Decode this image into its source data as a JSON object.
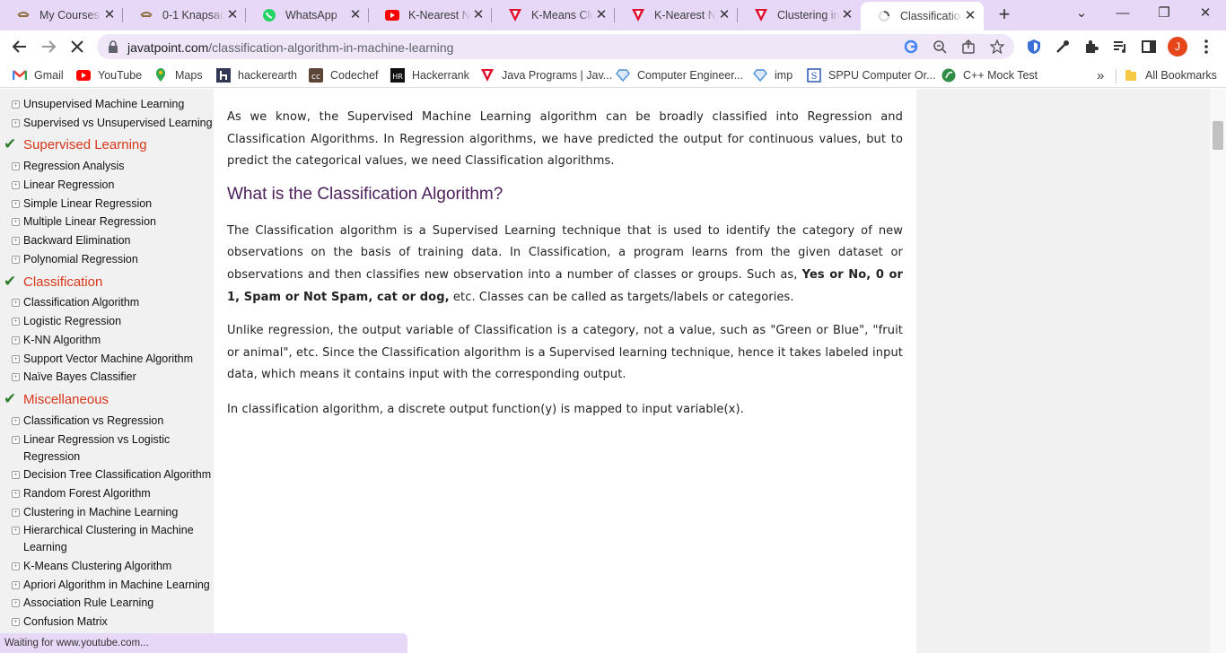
{
  "tabs": [
    {
      "title": "My Courses",
      "icon": "course-icon"
    },
    {
      "title": "0-1 Knapsack",
      "icon": "course-icon"
    },
    {
      "title": "WhatsApp",
      "icon": "whatsapp-icon"
    },
    {
      "title": "K-Nearest Neighbor",
      "icon": "youtube-icon"
    },
    {
      "title": "K-Means Clustering",
      "icon": "javatpoint-icon"
    },
    {
      "title": "K-Nearest Neighbor",
      "icon": "javatpoint-icon"
    },
    {
      "title": "Clustering in",
      "icon": "javatpoint-icon"
    },
    {
      "title": "Classification",
      "icon": "loading-icon",
      "active": true
    }
  ],
  "toolbar": {
    "url_host": "javatpoint.com",
    "url_path": "/classification-algorithm-in-machine-learning",
    "profile_initial": "J"
  },
  "bookmarks": [
    {
      "label": "Gmail",
      "icon": "gmail-icon"
    },
    {
      "label": "YouTube",
      "icon": "youtube-icon"
    },
    {
      "label": "Maps",
      "icon": "maps-icon"
    },
    {
      "label": "hackerearth",
      "icon": "hackerearth-icon"
    },
    {
      "label": "Codechef",
      "icon": "codechef-icon"
    },
    {
      "label": "Hackerrank",
      "icon": "hackerrank-icon"
    },
    {
      "label": "Java Programs | Jav...",
      "icon": "javatpoint-icon"
    },
    {
      "label": "Computer Engineer...",
      "icon": "diamond-icon"
    },
    {
      "label": "imp",
      "icon": "diamond-icon"
    },
    {
      "label": "SPPU Computer Or...",
      "icon": "sppu-icon"
    },
    {
      "label": "C++ Mock Test",
      "icon": "leaf-icon"
    }
  ],
  "bookmarks_overflow": "»",
  "all_bookmarks": "All Bookmarks",
  "sidebar": {
    "group_top": [
      "Unsupervised Machine Learning",
      "Supervised vs Unsupervised Learning"
    ],
    "heading_supervised": "Supervised Learning",
    "supervised": [
      "Regression Analysis",
      "Linear Regression",
      "Simple Linear Regression",
      "Multiple Linear Regression",
      "Backward Elimination",
      "Polynomial Regression"
    ],
    "heading_classification": "Classification",
    "classification": [
      "Classification Algorithm",
      "Logistic Regression",
      "K-NN Algorithm",
      "Support Vector Machine Algorithm",
      "Naïve Bayes Classifier"
    ],
    "heading_misc": "Miscellaneous",
    "misc": [
      "Classification vs Regression",
      "Linear Regression vs Logistic Regression",
      "Decision Tree Classification Algorithm",
      "Random Forest Algorithm",
      "Clustering in Machine Learning",
      "Hierarchical Clustering in Machine Learning",
      "K-Means Clustering Algorithm",
      "Apriori Algorithm in Machine Learning",
      "Association Rule Learning",
      "Confusion Matrix"
    ]
  },
  "content": {
    "intro": "As we know, the Supervised Machine Learning algorithm can be broadly classified into Regression and Classification Algorithms. In Regression algorithms, we have predicted the output for continuous values, but to predict the categorical values, we need Classification algorithms.",
    "heading": "What is the Classification Algorithm?",
    "p1_a": "The Classification algorithm is a Supervised Learning technique that is used to identify the category of new observations on the basis of training data. In Classification, a program learns from the given dataset or observations and then classifies new observation into a number of classes or groups. Such as, ",
    "p1_bold": "Yes or No, 0 or 1, Spam or Not Spam, cat or dog,",
    "p1_b": " etc. Classes can be called as targets/labels or categories.",
    "p2": "Unlike regression, the output variable of Classification is a category, not a value, such as \"Green or Blue\", \"fruit or animal\", etc. Since the Classification algorithm is a Supervised learning technique, hence it takes labeled input data, which means it contains input with the corresponding output.",
    "p3": "In classification algorithm, a discrete output function(y) is mapped to input variable(x)."
  },
  "status": "Waiting for www.youtube.com...",
  "colors": {
    "tabstrip": "#e8d8f8",
    "accent_heading": "#d8361a",
    "check": "#2d7d2d",
    "article_heading": "#4b1f5a"
  }
}
